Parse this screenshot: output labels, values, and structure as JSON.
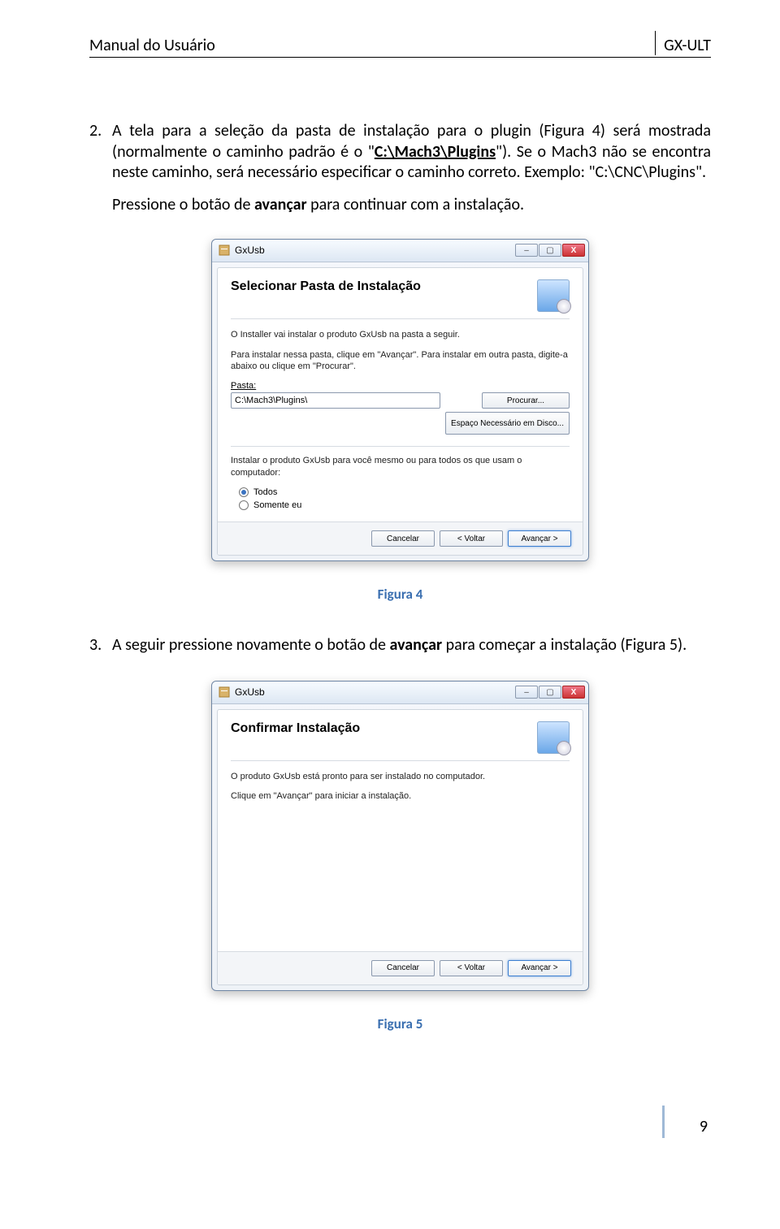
{
  "header": {
    "left": "Manual do Usuário",
    "right": "GX-ULT"
  },
  "item2": {
    "num": "2.",
    "p1_a": "A tela para a seleção da pasta de instalação para o plugin (Figura 4) será mostrada (normalmente o caminho padrão é o \"",
    "p1_bold": "C:\\Mach3\\Plugins",
    "p1_b": "\"). Se o Mach3 não se encontra neste caminho, será necessário especificar o caminho correto. Exemplo: \"C:\\CNC\\Plugins\".",
    "press_a": "Pressione o botão de ",
    "press_bold": "avançar",
    "press_b": " para continuar com a instalação."
  },
  "dialog1": {
    "title": "GxUsb",
    "heading": "Selecionar Pasta de Instalação",
    "text1": "O Installer vai instalar o produto GxUsb na pasta a seguir.",
    "text2": "Para instalar nessa pasta, clique em \"Avançar\". Para instalar em outra pasta, digite-a abaixo ou clique em \"Procurar\".",
    "folder_label": "Pasta:",
    "folder_value": "C:\\Mach3\\Plugins\\",
    "browse_btn": "Procurar...",
    "diskspace_btn": "Espaço Necessário em Disco...",
    "install_for_label": "Instalar o produto GxUsb para você mesmo ou para todos os que usam o computador:",
    "radio_everyone": "Todos",
    "radio_me": "Somente eu",
    "cancel": "Cancelar",
    "back": "< Voltar",
    "next": "Avançar >"
  },
  "caption1": "Figura 4",
  "item3": {
    "num": "3.",
    "p_a": "A seguir pressione novamente o botão de ",
    "p_bold": "avançar",
    "p_b": " para começar a instalação (Figura 5)."
  },
  "dialog2": {
    "title": "GxUsb",
    "heading": "Confirmar Instalação",
    "text1": "O produto GxUsb está pronto para ser instalado no computador.",
    "text2": "Clique em \"Avançar\" para iniciar a instalação.",
    "cancel": "Cancelar",
    "back": "< Voltar",
    "next": "Avançar >"
  },
  "caption2": "Figura 5",
  "page_number": "9"
}
